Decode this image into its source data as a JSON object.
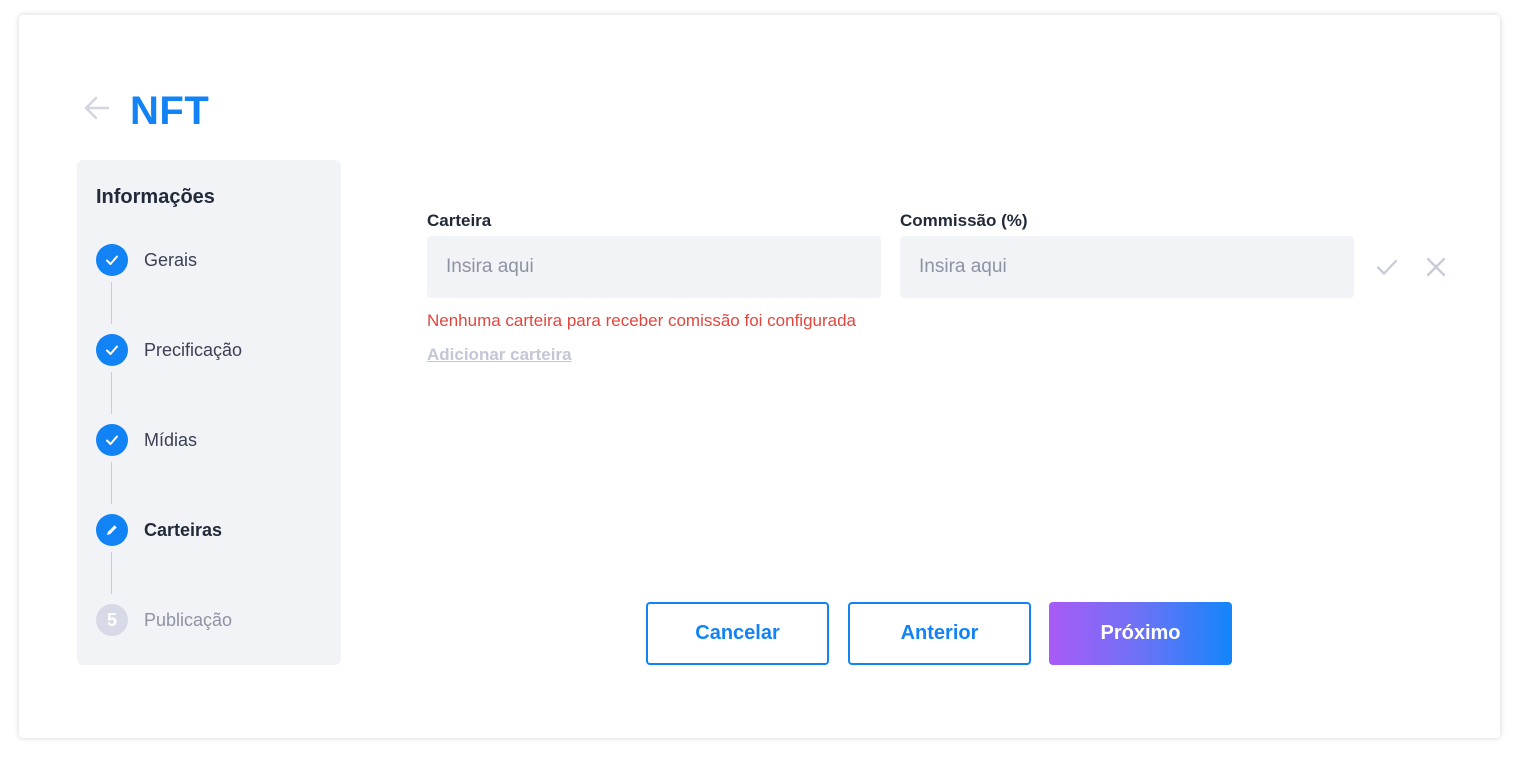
{
  "header": {
    "title": "NFT",
    "back_icon": "arrow-left-icon"
  },
  "sidebar": {
    "title": "Informações",
    "steps": [
      {
        "label": "Gerais",
        "status": "done",
        "icon": "check-icon"
      },
      {
        "label": "Precificação",
        "status": "done",
        "icon": "check-icon"
      },
      {
        "label": "Mídias",
        "status": "done",
        "icon": "check-icon"
      },
      {
        "label": "Carteiras",
        "status": "active",
        "icon": "pencil-icon"
      },
      {
        "label": "Publicação",
        "status": "pending",
        "number": "5"
      }
    ]
  },
  "form": {
    "wallet": {
      "label": "Carteira",
      "placeholder": "Insira aqui",
      "value": ""
    },
    "commission": {
      "label": "Commissão (%)",
      "placeholder": "Insira aqui",
      "value": ""
    },
    "confirm_icon": "check-icon",
    "cancel_icon": "close-icon",
    "error": "Nenhuma carteira para receber comissão foi configurada",
    "add_wallet_link": "Adicionar carteira"
  },
  "footer": {
    "cancel_label": "Cancelar",
    "previous_label": "Anterior",
    "next_label": "Próximo"
  },
  "colors": {
    "accent": "#1283f5",
    "error": "#e0463e",
    "panel": "#f2f3f7",
    "gradient_start": "#a95af6",
    "gradient_end": "#1386fb"
  }
}
